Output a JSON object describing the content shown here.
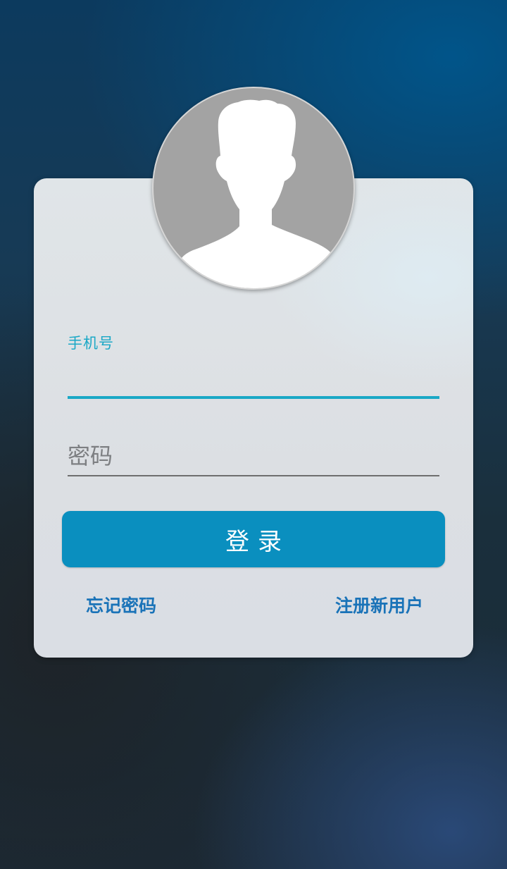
{
  "form": {
    "phone_label": "手机号",
    "phone_value": "",
    "password_placeholder": "密码",
    "password_value": ""
  },
  "actions": {
    "login_label": "登录",
    "forgot_password_label": "忘记密码",
    "register_label": "注册新用户"
  },
  "avatar": {
    "icon": "default-user-icon"
  },
  "colors": {
    "accent": "#1aa8c6",
    "button": "#0a8fbf",
    "link": "#1a73b8"
  }
}
